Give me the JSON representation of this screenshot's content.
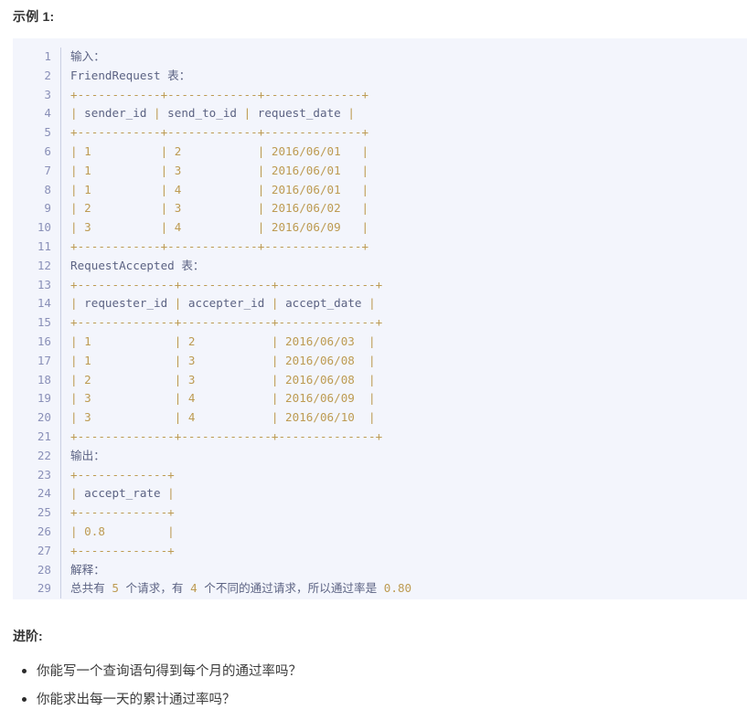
{
  "section": {
    "heading": "示例 1:"
  },
  "code_block": {
    "language": "text",
    "background_color": "#f3f5fc",
    "line_number_color": "#8a90b8",
    "punctuation_color": "#bd9b52",
    "text_color": "#5c6383",
    "total_lines": 29,
    "lines": [
      {
        "n": 1,
        "tokens": [
          {
            "t": "输入：",
            "c": "plain"
          }
        ]
      },
      {
        "n": 2,
        "tokens": [
          {
            "t": "FriendRequest 表：",
            "c": "plain"
          }
        ]
      },
      {
        "n": 3,
        "tokens": [
          {
            "t": "+------------+-------------+--------------+",
            "c": "punc"
          }
        ]
      },
      {
        "n": 4,
        "tokens": [
          {
            "t": "|",
            "c": "punc"
          },
          {
            "t": " sender_id ",
            "c": "plain"
          },
          {
            "t": "|",
            "c": "punc"
          },
          {
            "t": " send_to_id ",
            "c": "plain"
          },
          {
            "t": "|",
            "c": "punc"
          },
          {
            "t": " request_date ",
            "c": "plain"
          },
          {
            "t": "|",
            "c": "punc"
          }
        ]
      },
      {
        "n": 5,
        "tokens": [
          {
            "t": "+------------+-------------+--------------+",
            "c": "punc"
          }
        ]
      },
      {
        "n": 6,
        "tokens": [
          {
            "t": "| 1          | 2           | 2016/06/01   |",
            "c": "punc"
          }
        ]
      },
      {
        "n": 7,
        "tokens": [
          {
            "t": "| 1          | 3           | 2016/06/01   |",
            "c": "punc"
          }
        ]
      },
      {
        "n": 8,
        "tokens": [
          {
            "t": "| 1          | 4           | 2016/06/01   |",
            "c": "punc"
          }
        ]
      },
      {
        "n": 9,
        "tokens": [
          {
            "t": "| 2          | 3           | 2016/06/02   |",
            "c": "punc"
          }
        ]
      },
      {
        "n": 10,
        "tokens": [
          {
            "t": "| 3          | 4           | 2016/06/09   |",
            "c": "punc"
          }
        ]
      },
      {
        "n": 11,
        "tokens": [
          {
            "t": "+------------+-------------+--------------+",
            "c": "punc"
          }
        ]
      },
      {
        "n": 12,
        "tokens": [
          {
            "t": "RequestAccepted 表：",
            "c": "plain"
          }
        ]
      },
      {
        "n": 13,
        "tokens": [
          {
            "t": "+--------------+-------------+--------------+",
            "c": "punc"
          }
        ]
      },
      {
        "n": 14,
        "tokens": [
          {
            "t": "|",
            "c": "punc"
          },
          {
            "t": " requester_id ",
            "c": "plain"
          },
          {
            "t": "|",
            "c": "punc"
          },
          {
            "t": " accepter_id ",
            "c": "plain"
          },
          {
            "t": "|",
            "c": "punc"
          },
          {
            "t": " accept_date ",
            "c": "plain"
          },
          {
            "t": "|",
            "c": "punc"
          }
        ]
      },
      {
        "n": 15,
        "tokens": [
          {
            "t": "+--------------+-------------+--------------+",
            "c": "punc"
          }
        ]
      },
      {
        "n": 16,
        "tokens": [
          {
            "t": "| 1            | 2           | 2016/06/03  |",
            "c": "punc"
          }
        ]
      },
      {
        "n": 17,
        "tokens": [
          {
            "t": "| 1            | 3           | 2016/06/08  |",
            "c": "punc"
          }
        ]
      },
      {
        "n": 18,
        "tokens": [
          {
            "t": "| 2            | 3           | 2016/06/08  |",
            "c": "punc"
          }
        ]
      },
      {
        "n": 19,
        "tokens": [
          {
            "t": "| 3            | 4           | 2016/06/09  |",
            "c": "punc"
          }
        ]
      },
      {
        "n": 20,
        "tokens": [
          {
            "t": "| 3            | 4           | 2016/06/10  |",
            "c": "punc"
          }
        ]
      },
      {
        "n": 21,
        "tokens": [
          {
            "t": "+--------------+-------------+--------------+",
            "c": "punc"
          }
        ]
      },
      {
        "n": 22,
        "tokens": [
          {
            "t": "输出：",
            "c": "plain"
          }
        ]
      },
      {
        "n": 23,
        "tokens": [
          {
            "t": "+-------------+",
            "c": "punc"
          }
        ]
      },
      {
        "n": 24,
        "tokens": [
          {
            "t": "|",
            "c": "punc"
          },
          {
            "t": " accept_rate ",
            "c": "plain"
          },
          {
            "t": "|",
            "c": "punc"
          }
        ]
      },
      {
        "n": 25,
        "tokens": [
          {
            "t": "+-------------+",
            "c": "punc"
          }
        ]
      },
      {
        "n": 26,
        "tokens": [
          {
            "t": "| 0.8         |",
            "c": "punc"
          }
        ]
      },
      {
        "n": 27,
        "tokens": [
          {
            "t": "+-------------+",
            "c": "punc"
          }
        ]
      },
      {
        "n": 28,
        "tokens": [
          {
            "t": "解释：",
            "c": "plain"
          }
        ]
      },
      {
        "n": 29,
        "tokens": [
          {
            "t": "总共有 ",
            "c": "plain"
          },
          {
            "t": "5",
            "c": "num"
          },
          {
            "t": " 个请求，有 ",
            "c": "plain"
          },
          {
            "t": "4",
            "c": "num"
          },
          {
            "t": " 个不同的通过请求，所以通过率是 ",
            "c": "plain"
          },
          {
            "t": "0.80",
            "c": "num"
          }
        ]
      }
    ]
  },
  "followup": {
    "heading": "进阶:",
    "items": [
      {
        "text": "你能写一个查询语句得到每个月的通过率吗？"
      },
      {
        "text": "你能求出每一天的累计通过率吗？"
      }
    ]
  }
}
